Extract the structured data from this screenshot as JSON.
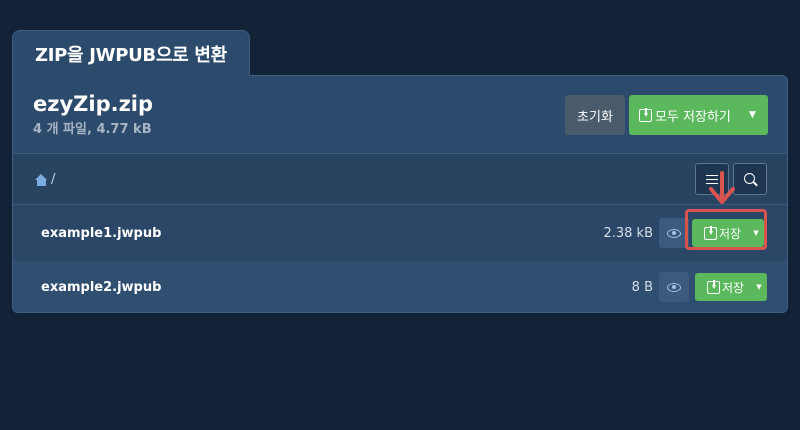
{
  "tab": {
    "title": "ZIP을 JWPUB으로 변환"
  },
  "archive": {
    "name": "ezyZip.zip",
    "meta": "4 개 파일, 4.77 kB",
    "reset_label": "초기화",
    "save_all_label": "모두 저장하기"
  },
  "breadcrumb": {
    "path": "/"
  },
  "files": [
    {
      "name": "example1.jwpub",
      "size": "2.38 kB",
      "save_label": "저장"
    },
    {
      "name": "example2.jwpub",
      "size": "8 B",
      "save_label": "저장"
    }
  ],
  "colors": {
    "background": "#122237",
    "panel": "#2c4a6b",
    "green": "#5cb85c",
    "highlight": "#d9534f"
  }
}
